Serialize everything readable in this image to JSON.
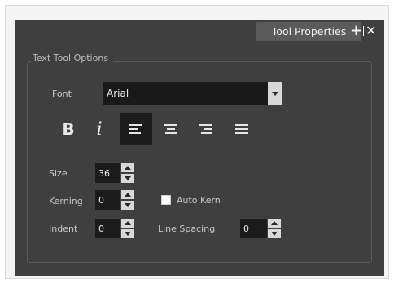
{
  "tab": {
    "title": "Tool Properties",
    "add_icon": "plus-icon",
    "close_icon": "close-icon"
  },
  "group": {
    "title": "Text Tool Options"
  },
  "font": {
    "label": "Font",
    "value": "Arial"
  },
  "style_buttons": [
    {
      "icon": "bold-icon",
      "glyph": "B"
    },
    {
      "icon": "italic-icon",
      "glyph": "i"
    },
    {
      "icon": "align-left-icon"
    },
    {
      "icon": "align-center-icon"
    },
    {
      "icon": "align-right-icon"
    },
    {
      "icon": "justify-icon"
    }
  ],
  "size": {
    "label": "Size",
    "value": "36"
  },
  "kerning": {
    "label": "Kerning",
    "value": "0"
  },
  "auto_kern": {
    "label": "Auto Kern",
    "checked": false
  },
  "indent": {
    "label": "Indent",
    "value": "0"
  },
  "line_spacing": {
    "label": "Line Spacing",
    "value": "0"
  },
  "colors": {
    "panel": "#3f3f3f",
    "input": "#1b1b1b",
    "selected": "#1c1c1c"
  }
}
